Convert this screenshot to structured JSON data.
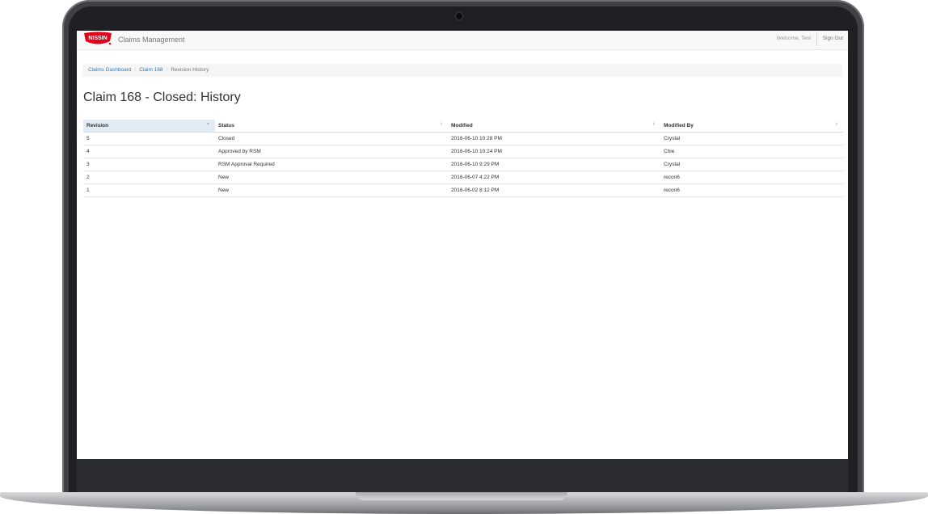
{
  "app": {
    "title": "Claims Management",
    "brand_colors": {
      "logo_red": "#e2001a",
      "link": "#337ab7",
      "sorted_header": "#e3ecf5"
    }
  },
  "nav": {
    "welcome": "Welcome, Test",
    "sign_out": "Sign Out"
  },
  "breadcrumb": {
    "items": [
      "Claims Dashboard",
      "Claim 168"
    ],
    "current": "Revision History",
    "separator": "/"
  },
  "page": {
    "title": "Claim 168 - Closed: History"
  },
  "table": {
    "headers": [
      "Revision",
      "Status",
      "Modified",
      "Modified By"
    ],
    "sorted_column": "Revision",
    "rows": [
      {
        "revision": "5",
        "status": "Closed",
        "modified": "2016-06-10 10:28 PM",
        "modified_by": "Crystal"
      },
      {
        "revision": "4",
        "status": "Approved by RSM",
        "modified": "2016-06-10 10:24 PM",
        "modified_by": "Chie"
      },
      {
        "revision": "3",
        "status": "RSM Approval Required",
        "modified": "2016-06-10 9:29 PM",
        "modified_by": "Crystal"
      },
      {
        "revision": "2",
        "status": "New",
        "modified": "2016-06-07 4:22 PM",
        "modified_by": "recon6"
      },
      {
        "revision": "1",
        "status": "New",
        "modified": "2016-06-02 8:12 PM",
        "modified_by": "recon6"
      }
    ]
  },
  "icons": {
    "logo": "nissin-logo",
    "sort_desc": "sort-desc-icon",
    "sort_both": "sort-both-icon"
  }
}
